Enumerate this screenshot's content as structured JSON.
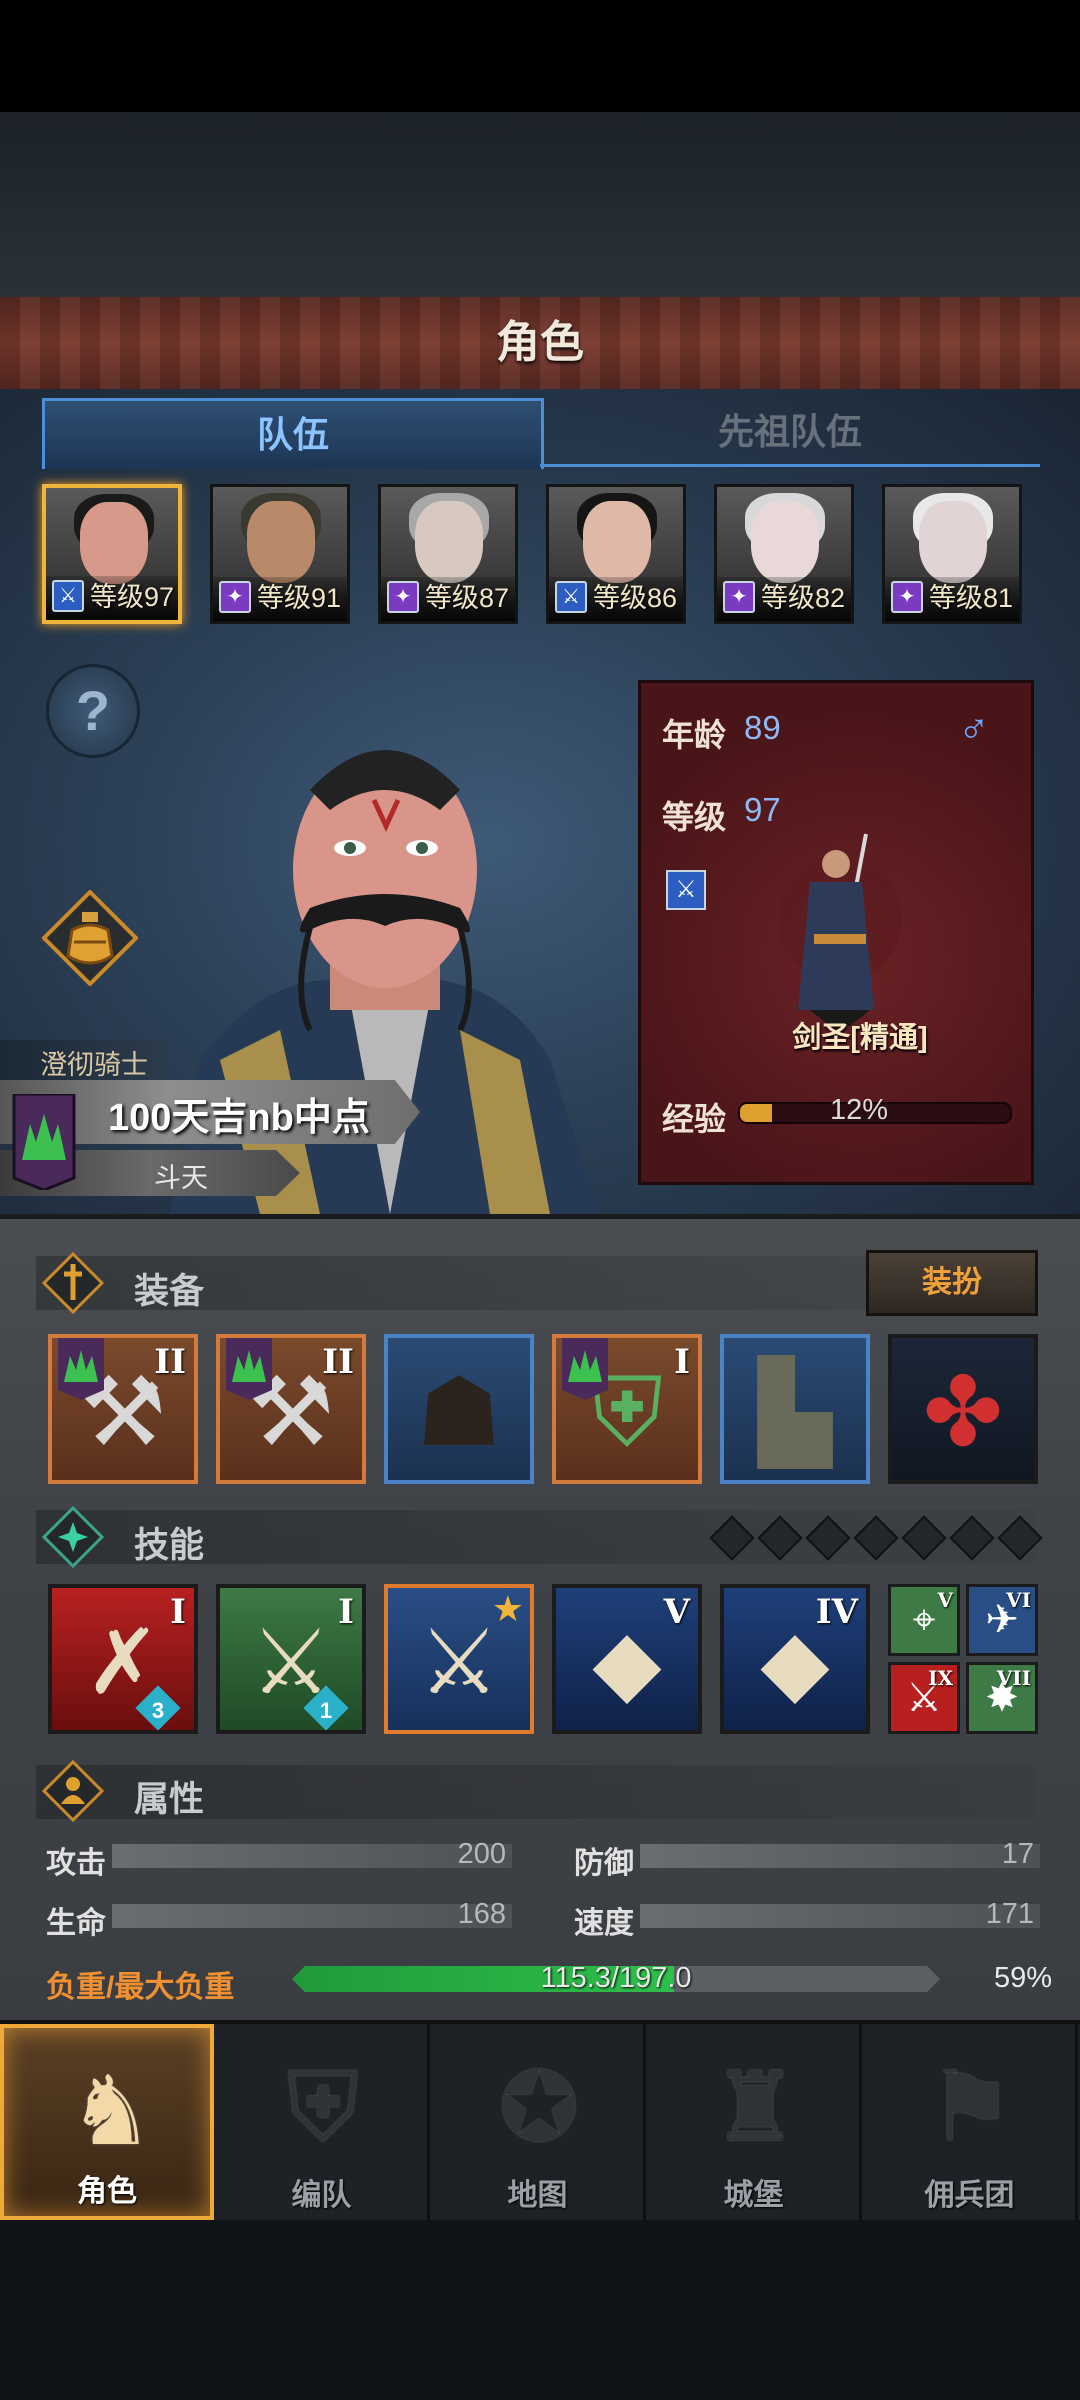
{
  "header": {
    "title": "角色"
  },
  "tabs": [
    {
      "label": "队伍",
      "active": true
    },
    {
      "label": "先祖队伍",
      "active": false
    }
  ],
  "roster": [
    {
      "level_label": "等级97",
      "selected": true,
      "class_icon": "sword-icon"
    },
    {
      "level_label": "等级91",
      "selected": false,
      "class_icon": "staff-icon"
    },
    {
      "level_label": "等级87",
      "selected": false,
      "class_icon": "staff-icon"
    },
    {
      "level_label": "等级86",
      "selected": false,
      "class_icon": "sword-icon"
    },
    {
      "level_label": "等级82",
      "selected": false,
      "class_icon": "staff-icon"
    },
    {
      "level_label": "等级81",
      "selected": false,
      "class_icon": "staff-icon"
    }
  ],
  "help": {
    "glyph": "?"
  },
  "character": {
    "title": "澄彻骑士",
    "name": "100天吉nb中点",
    "guild": "斗天",
    "age_label": "年龄",
    "age": "89",
    "gender_glyph": "♂",
    "level_label": "等级",
    "level": "97",
    "class_name": "剑圣[精通]",
    "exp_label": "经验",
    "exp_percent_text": "12%",
    "exp_fraction": 0.12
  },
  "equipment": {
    "title": "装备",
    "outfit_button": "装扮",
    "slots": [
      {
        "icon": "halberd-icon",
        "rarity": "orange",
        "rank": "II",
        "badge": true
      },
      {
        "icon": "halberd-icon",
        "rarity": "orange",
        "rank": "II",
        "badge": true
      },
      {
        "icon": "hood-icon",
        "rarity": "blue",
        "rank": "",
        "badge": false
      },
      {
        "icon": "armor-icon",
        "rarity": "orange",
        "rank": "I",
        "badge": true
      },
      {
        "icon": "boots-icon",
        "rarity": "blue",
        "rank": "",
        "badge": false
      },
      {
        "icon": "knot-charm-icon",
        "rarity": "red",
        "rank": "",
        "badge": false
      }
    ]
  },
  "skills": {
    "title": "技能",
    "slots_total": 7,
    "items": [
      {
        "icon": "triple-strike-icon",
        "rank": "I",
        "gem": "3"
      },
      {
        "icon": "sword-slash-icon",
        "rank": "I",
        "gem": "1"
      },
      {
        "icon": "blade-flurry-icon",
        "rank": "",
        "star": true
      },
      {
        "icon": "crystal-sword-icon",
        "rank": "V"
      },
      {
        "icon": "crystal-dash-icon",
        "rank": "IV"
      }
    ],
    "passives": [
      {
        "icon": "crosshair-icon",
        "rank": "V"
      },
      {
        "icon": "bird-icon",
        "rank": "VI"
      },
      {
        "icon": "red-sword-icon",
        "rank": "IX"
      },
      {
        "icon": "burst-icon",
        "rank": "VII"
      }
    ]
  },
  "attributes": {
    "title": "属性",
    "attack_label": "攻击",
    "attack": "200",
    "defense_label": "防御",
    "defense": "17",
    "hp_label": "生命",
    "hp": "168",
    "speed_label": "速度",
    "speed": "171",
    "load_label": "负重/最大负重",
    "load_text": "115.3/197.0",
    "load_percent_text": "59%",
    "load_fraction": 0.59
  },
  "nav": [
    {
      "label": "角色",
      "icon": "knight-icon",
      "active": true
    },
    {
      "label": "编队",
      "icon": "formation-icon",
      "active": false
    },
    {
      "label": "地图",
      "icon": "compass-map-icon",
      "active": false
    },
    {
      "label": "城堡",
      "icon": "castle-icon",
      "active": false
    },
    {
      "label": "佣兵团",
      "icon": "mercenary-icon",
      "active": false
    }
  ],
  "colors": {
    "accent_gold": "#f0b43a",
    "tab_blue": "#4c8fd6",
    "load_green": "#2ec04a",
    "card_red": "#6a2226",
    "orange_label": "#f09030"
  }
}
